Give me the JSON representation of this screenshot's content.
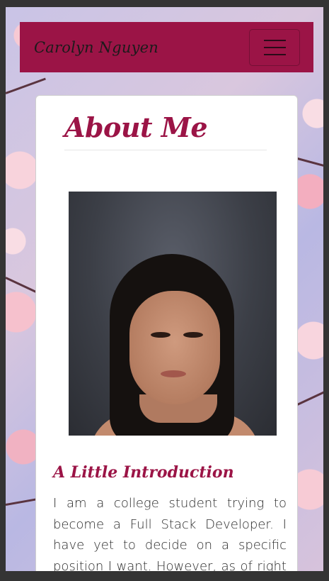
{
  "navbar": {
    "brand": "Carolyn Nguyen",
    "menu_icon": "hamburger-menu-icon"
  },
  "about": {
    "title": "About Me",
    "photo_icon": "profile-photo",
    "subtitle": "A Little Introduction",
    "intro_text": "I am a college student trying to become a Full Stack Developer. I have yet to decide on a specific position I want. However, as of right now I am thinking"
  },
  "colors": {
    "accent": "#9b1446",
    "page_frame": "#343434",
    "card": "#ffffff"
  }
}
